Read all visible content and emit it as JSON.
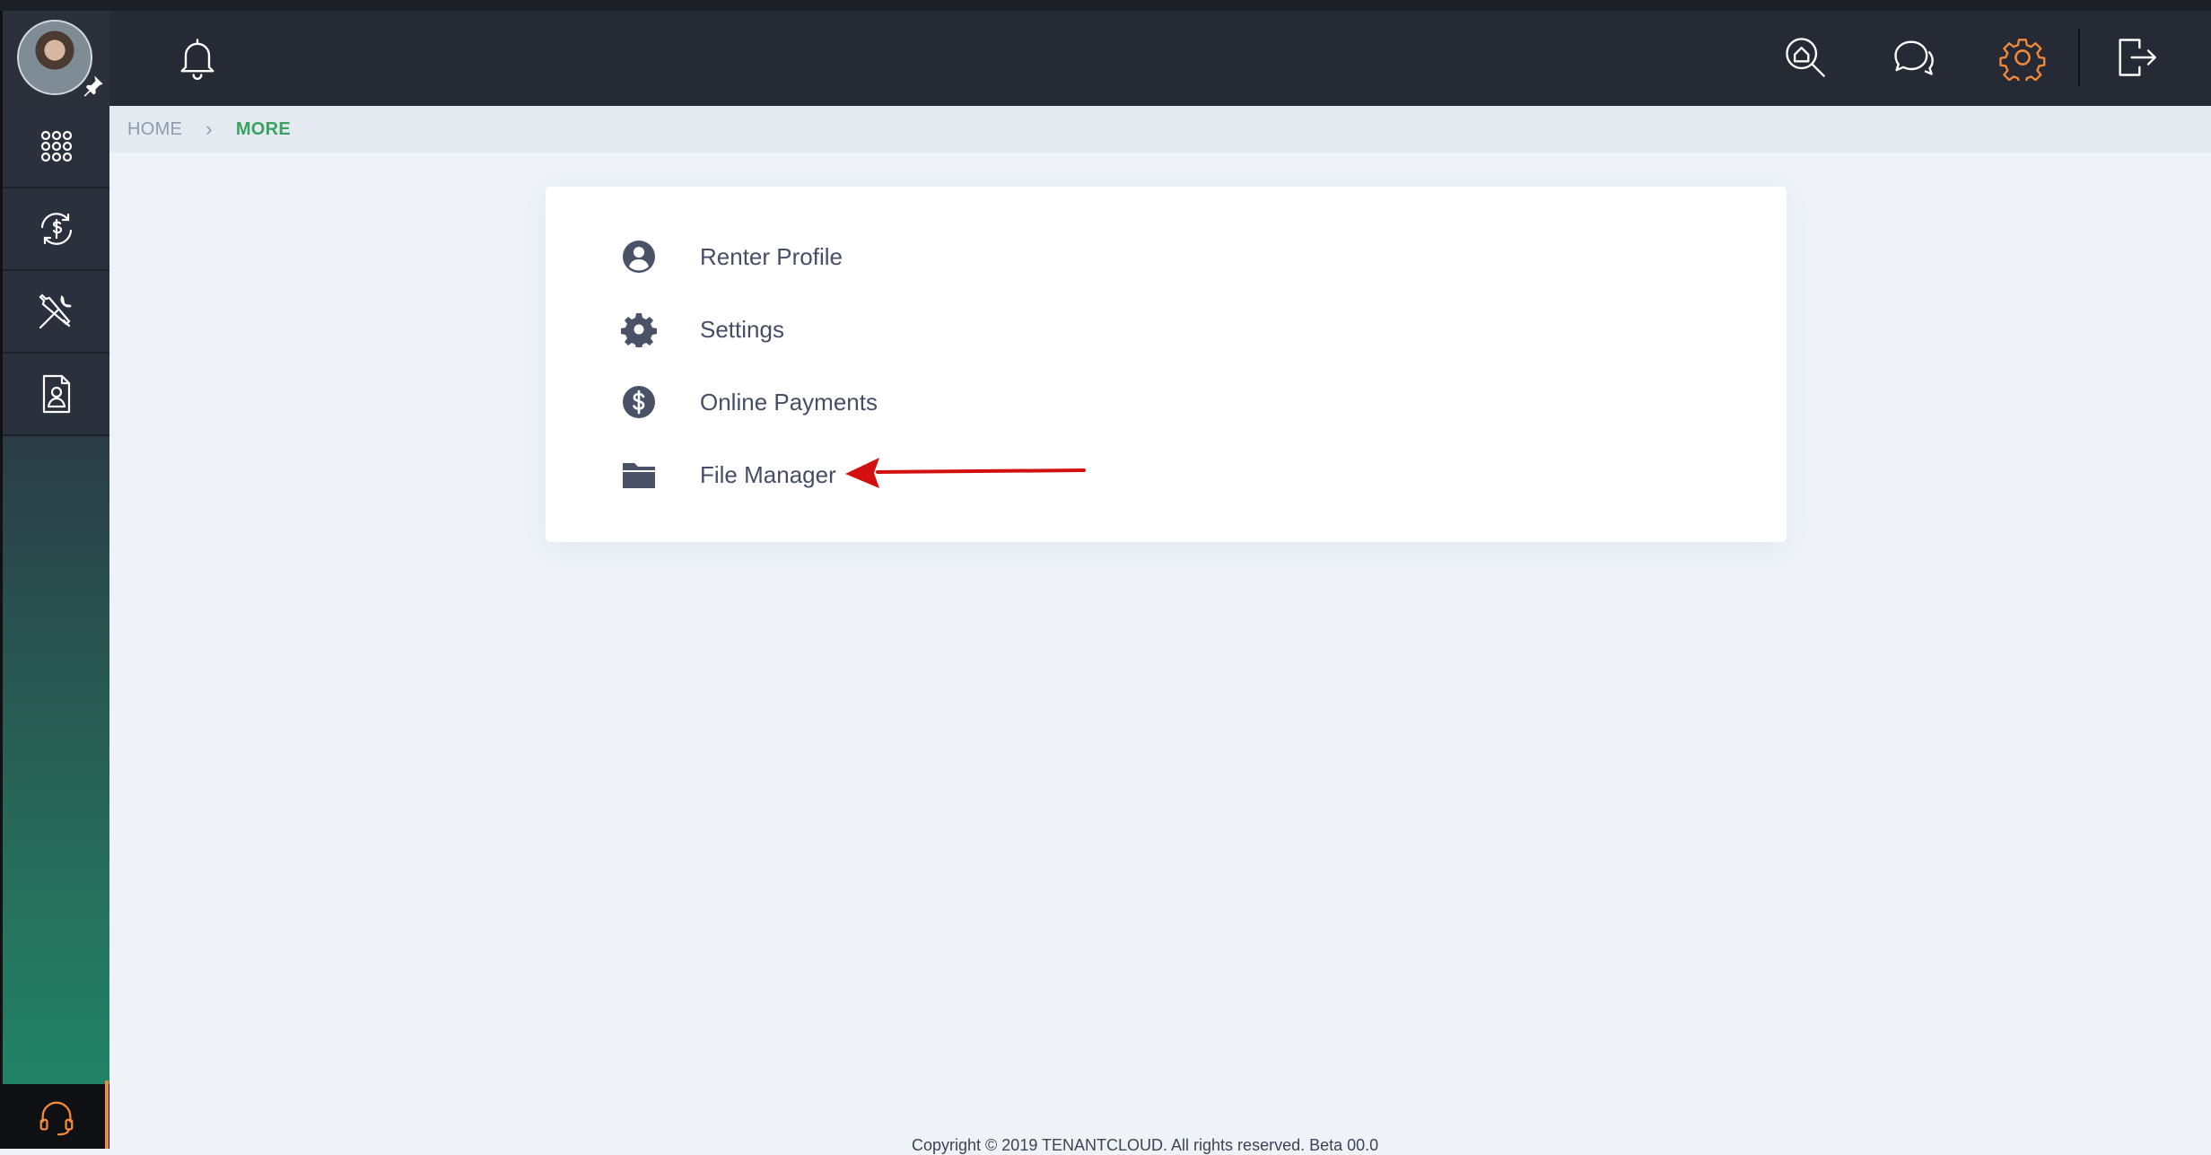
{
  "breadcrumb": {
    "home": "HOME",
    "separator": "›",
    "current": "MORE"
  },
  "menu": {
    "items": [
      {
        "label": "Renter Profile",
        "icon": "user-circle-icon"
      },
      {
        "label": "Settings",
        "icon": "gear-icon"
      },
      {
        "label": "Online Payments",
        "icon": "dollar-circle-icon"
      },
      {
        "label": "File Manager",
        "icon": "folder-icon"
      }
    ]
  },
  "topbar": {
    "icons": [
      "bell-icon",
      "property-search-icon",
      "chat-icon",
      "settings-gear-icon",
      "logout-icon"
    ]
  },
  "sidebar": {
    "icons": [
      "apps-grid-icon",
      "payments-cycle-icon",
      "maintenance-tools-icon",
      "lease-document-icon",
      "support-headset-icon"
    ]
  },
  "footer": {
    "copyright": "Copyright © 2019 TENANTCLOUD. All rights reserved. Beta 00.0"
  },
  "colors": {
    "topbar_bg": "#262a35",
    "accent_orange": "#f08a3a",
    "breadcrumb_active": "#3aa363",
    "menu_text": "#454e66",
    "annotation_arrow": "#d40f10"
  }
}
